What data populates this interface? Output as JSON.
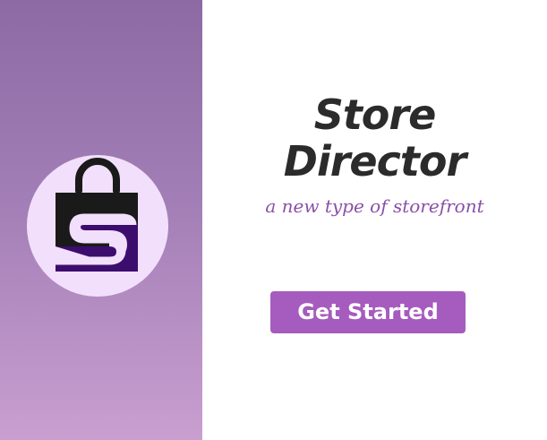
{
  "brand": {
    "title_line_1": "Store",
    "title_line_2": "Director",
    "tagline": "a new type of storefront",
    "logo_icon": "shopping-bag-s-icon"
  },
  "actions": {
    "get_started_label": "Get Started"
  },
  "colors": {
    "panel_gradient_top": "#8d6aa3",
    "panel_gradient_bottom": "#c99fd0",
    "logo_circle": "#f2dffb",
    "logo_bag": "#1a1a1a",
    "logo_accent": "#3d0d6e",
    "tagline": "#8a4fa8",
    "button": "#a55cbe",
    "title": "#2b2b2b"
  }
}
